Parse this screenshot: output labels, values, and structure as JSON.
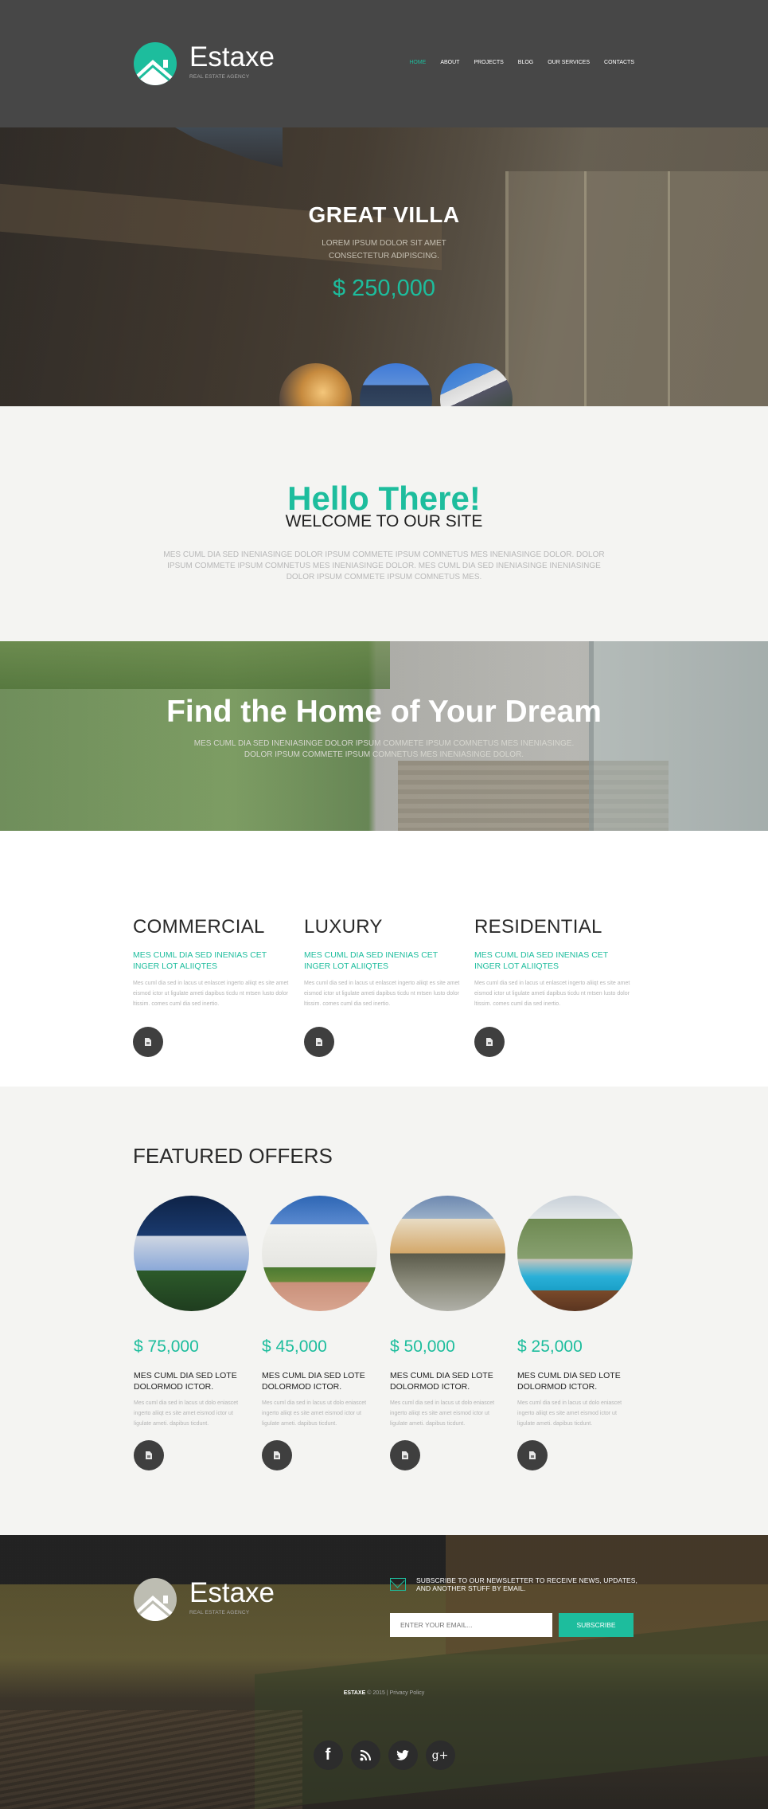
{
  "header": {
    "brand": "Estaxe",
    "tagline": "REAL ESTATE AGENCY",
    "logo_icon": "house-roof-icon",
    "nav": [
      {
        "label": "HOME",
        "active": true
      },
      {
        "label": "ABOUT",
        "active": false
      },
      {
        "label": "PROJECTS",
        "active": false
      },
      {
        "label": "BLOG",
        "active": false
      },
      {
        "label": "OUR SERVICES",
        "active": false
      },
      {
        "label": "CONTACTS",
        "active": false
      }
    ]
  },
  "hero": {
    "title": "GREAT VILLA",
    "description_line1": "LOREM IPSUM DOLOR SIT AMET",
    "description_line2": "CONSECTETUR ADIPISCING.",
    "price": "$ 250,000",
    "thumbnails": [
      "villa-thumb-1",
      "villa-thumb-2",
      "villa-thumb-3"
    ]
  },
  "welcome": {
    "hello": "Hello There!",
    "subtitle": "WELCOME TO OUR SITE",
    "text": "MES CUML DIA SED INENIASINGE DOLOR IPSUM COMMETE IPSUM COMNETUS MES INENIASINGE DOLOR. DOLOR IPSUM COMMETE IPSUM COMNETUS MES INENIASINGE DOLOR. MES CUML DIA SED INENIASINGE INENIASINGE DOLOR IPSUM COMMETE IPSUM COMNETUS MES."
  },
  "dream": {
    "title": "Find the Home of Your Dream",
    "text_line1": "MES CUML DIA SED INENIASINGE DOLOR IPSUM COMMETE IPSUM COMNETUS MES INENIASINGE.",
    "text_line2": "DOLOR IPSUM COMMETE IPSUM COMNETUS MES INENIASINGE DOLOR."
  },
  "categories": [
    {
      "title": "COMMERCIAL",
      "subtitle": "MES CUML DIA SED INENIAS CET INGER LOT ALIIQTES",
      "text": "Mes cuml dia sed in lacus ut enlascet ingerto aliiqt es site amet eismod ictor ut ligulate ameti dapibus ticdu nt mtsen lusto dolor ltissim. comes cuml dia sed inertio.",
      "icon": "document-icon"
    },
    {
      "title": "LUXURY",
      "subtitle": "MES CUML DIA SED INENIAS CET INGER LOT ALIIQTES",
      "text": "Mes cuml dia sed in lacus ut enlascet ingerto aliiqt es site amet eismod ictor ut ligulate ameti dapibus ticdu nt mtsen lusto dolor ltissim. comes cuml dia sed inertio.",
      "icon": "document-icon"
    },
    {
      "title": "RESIDENTIAL",
      "subtitle": "MES CUML DIA SED INENIAS CET INGER LOT ALIIQTES",
      "text": "Mes cuml dia sed in lacus ut enlascet ingerto aliiqt es site amet eismod ictor ut ligulate ameti dapibus ticdu nt mtsen lusto dolor ltissim. comes cuml dia sed inertio.",
      "icon": "document-icon"
    }
  ],
  "featured": {
    "title": "FEATURED OFFERS",
    "offers": [
      {
        "price": "$ 75,000",
        "title": "MES CUML DIA SED LOTE DOLORMOD ICTOR.",
        "text": "Mes cuml dia sed in lacus ut dolo eniascet ingerto aliiqt es site amet eismod ictor ut ligulate ameti. dapibus ticdunt.",
        "image": "modern-white-house-night"
      },
      {
        "price": "$ 45,000",
        "title": "MES CUML DIA SED LOTE DOLORMOD ICTOR.",
        "text": "Mes cuml dia sed in lacus ut dolo eniascet ingerto aliiqt es site amet eismod ictor ut ligulate ameti. dapibus ticdunt.",
        "image": "mediterranean-white-villa"
      },
      {
        "price": "$ 50,000",
        "title": "MES CUML DIA SED LOTE DOLORMOD ICTOR.",
        "text": "Mes cuml dia sed in lacus ut dolo eniascet ingerto aliiqt es site amet eismod ictor ut ligulate ameti. dapibus ticdunt.",
        "image": "modern-villa-dusk"
      },
      {
        "price": "$ 25,000",
        "title": "MES CUML DIA SED LOTE DOLORMOD ICTOR.",
        "text": "Mes cuml dia sed in lacus ut dolo eniascet ingerto aliiqt es site amet eismod ictor ut ligulate ameti. dapibus ticdunt.",
        "image": "house-with-pool"
      }
    ]
  },
  "footer": {
    "brand": "Estaxe",
    "tagline": "REAL ESTATE AGENCY",
    "newsletter_text": "SUBSCRIBE TO OUR NEWSLETTER TO RECEIVE NEWS, UPDATES, AND ANOTHER STUFF BY EMAIL.",
    "email_placeholder": "ENTER YOUR EMAIL...",
    "subscribe_label": "SUBSCRIBE",
    "copyright_brand": "ESTAXE",
    "copyright_year": "© 2015",
    "separator": "|",
    "privacy_label": "Privacy Policy",
    "social": [
      {
        "name": "facebook",
        "glyph": "f"
      },
      {
        "name": "rss",
        "glyph": ""
      },
      {
        "name": "twitter",
        "glyph": ""
      },
      {
        "name": "google-plus",
        "glyph": "g+"
      }
    ]
  },
  "colors": {
    "accent": "#1dbd9d",
    "header_bg": "#474747",
    "section_bg": "#f4f4f2",
    "icon_button_bg": "#3f3f3f"
  }
}
